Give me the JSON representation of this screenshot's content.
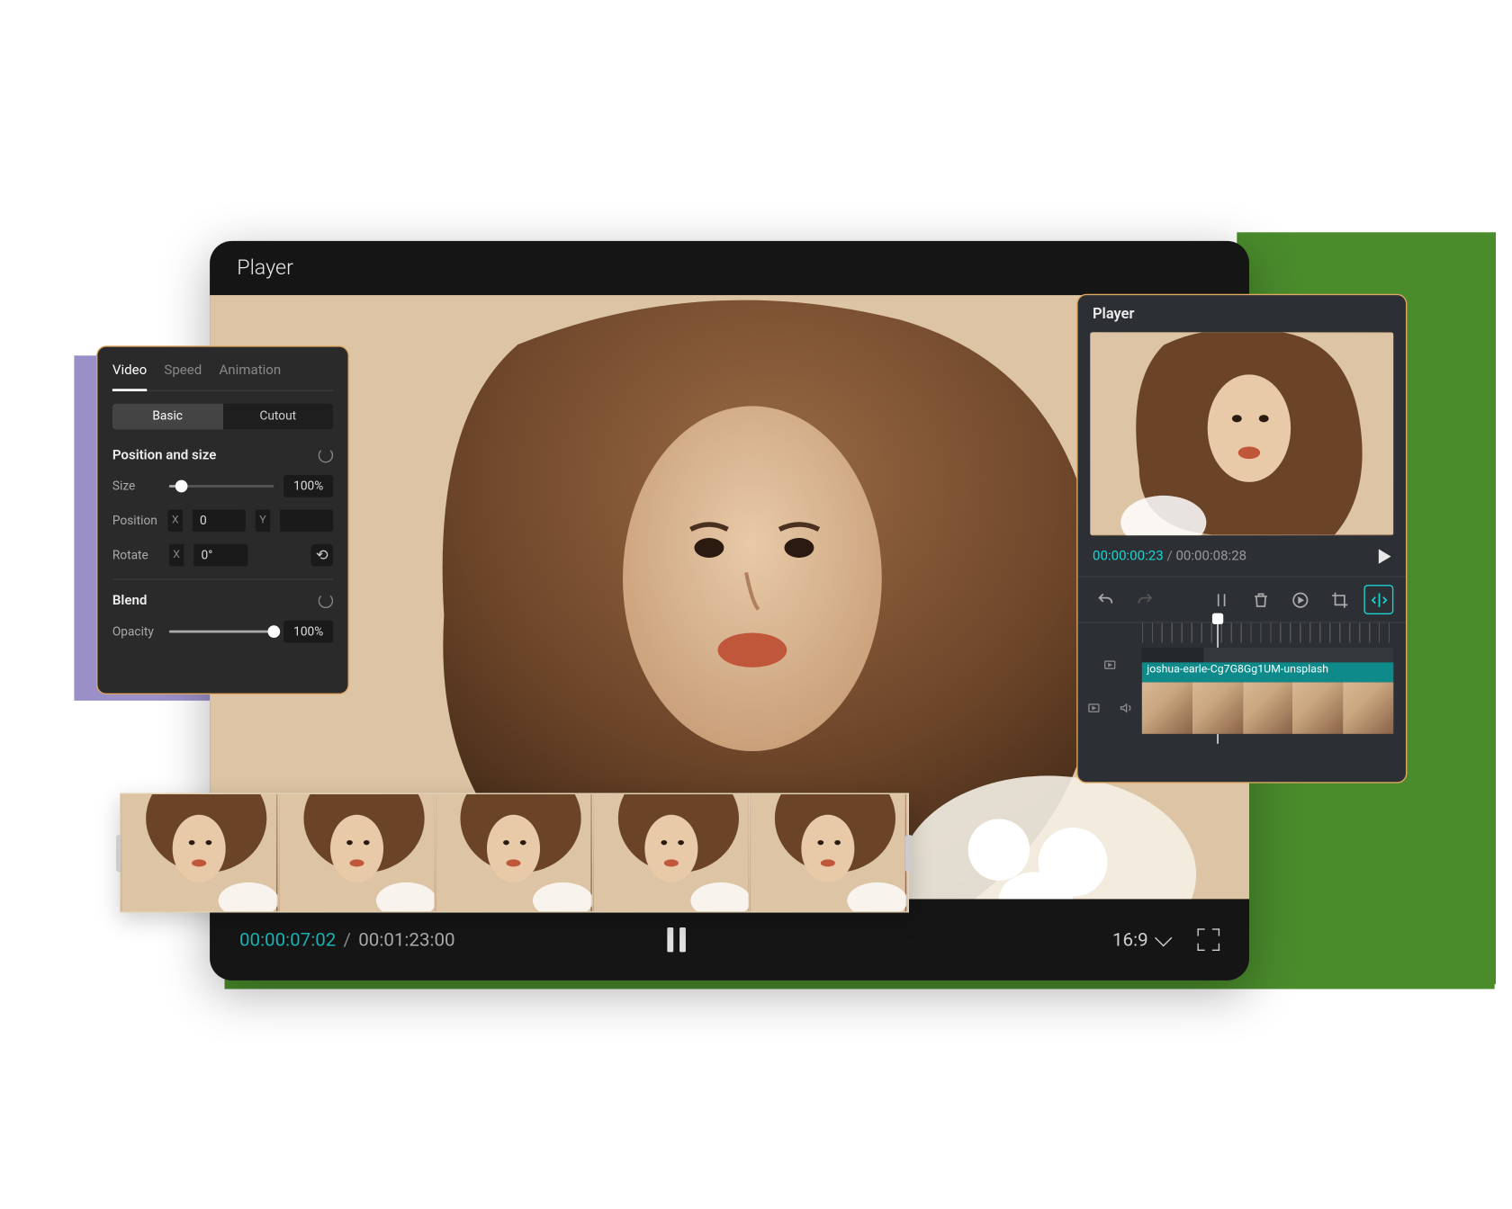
{
  "main_player": {
    "title": "Player",
    "time_current": "00:00:07:02",
    "time_total": "00:01:23:00",
    "aspect_ratio": "16:9"
  },
  "properties_panel": {
    "tabs": {
      "video": "Video",
      "speed": "Speed",
      "animation": "Animation"
    },
    "segments": {
      "basic": "Basic",
      "cutout": "Cutout"
    },
    "position_size": {
      "heading": "Position and size",
      "size_label": "Size",
      "size_value": "100%",
      "size_percent": 12,
      "position_label": "Position",
      "x_label": "X",
      "x_value": "0",
      "y_label": "Y",
      "y_value": "",
      "rotate_label": "Rotate",
      "rotate_x_label": "X",
      "rotate_value": "0°",
      "mirror_glyph": "⟲"
    },
    "blend": {
      "heading": "Blend",
      "opacity_label": "Opacity",
      "opacity_value": "100%",
      "opacity_percent": 100
    }
  },
  "mini_player": {
    "title": "Player",
    "time_current": "00:00:00:23",
    "time_total": "00:00:08:28",
    "clip_label": "joshua-earle-Cg7G8Gg1UM-unsplash"
  }
}
